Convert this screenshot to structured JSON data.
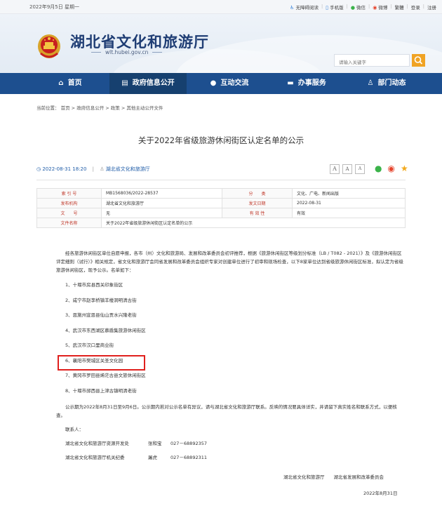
{
  "topbar": {
    "date": "2022年9月5日 星期一",
    "links": [
      {
        "icon": "accessibility-icon",
        "label": "无障碍阅读"
      },
      {
        "icon": "mobile-icon",
        "label": "手机版"
      },
      {
        "icon": "wechat-icon",
        "label": "微信"
      },
      {
        "icon": "weibo-icon",
        "label": "微博"
      },
      {
        "icon": "",
        "label": "繁體"
      },
      {
        "icon": "",
        "label": "登录"
      },
      {
        "icon": "",
        "label": "注册"
      }
    ]
  },
  "header": {
    "site_title": "湖北省文化和旅游厅",
    "domain": "wlt.hubei.gov.cn",
    "search_placeholder": "请输入关键字"
  },
  "nav": {
    "items": [
      {
        "label": "首页",
        "icon": "home-icon"
      },
      {
        "label": "政府信息公开",
        "icon": "document-list-icon"
      },
      {
        "label": "互动交流",
        "icon": "chat-bubble-icon"
      },
      {
        "label": "办事服务",
        "icon": "monitor-icon"
      },
      {
        "label": "部门动态",
        "icon": "person-icon"
      }
    ],
    "active_index": 1
  },
  "breadcrumb": {
    "prefix": "当前位置：",
    "items": [
      "首页",
      "政府信息公开",
      "政策",
      "其他主动公开文件"
    ],
    "separator": ">"
  },
  "article": {
    "title": "关于2022年省级旅游休闲街区认定名单的公示",
    "datetime": "2022-08-31 18:20",
    "source": "湖北省文化和旅游厅",
    "font_buttons": [
      "A",
      "A",
      "A"
    ]
  },
  "info_table": {
    "rows": [
      [
        {
          "k": "索 引 号",
          "v": "MB1568036/2022-28537"
        },
        {
          "k": "分　　类",
          "v": "文化、广电、新闻出版"
        }
      ],
      [
        {
          "k": "发布机构",
          "v": "湖北省文化和旅游厅"
        },
        {
          "k": "发文日期",
          "v": "2022-08-31"
        }
      ],
      [
        {
          "k": "文　　号",
          "v": "无"
        },
        {
          "k": "有 效 性",
          "v": "有效"
        }
      ],
      [
        {
          "k": "文件名称",
          "v": "关于2022年省级旅游休闲街区认定名单的公示"
        }
      ]
    ]
  },
  "content": {
    "intro": "经各旅游休闲街区单位自愿申报，各市（州）文化和旅游局、发展和改革委员会初评推荐，根据《旅游休闲街区等级划分标准（LB / T082 - 2021）》及《旅游休闲街区评定细则（试行）》相关规定，省文化和旅游厅会同省发展和改革委员会组织专家对创建单位进行了初审和现场检查，以下8家单位达到省级旅游休闲街区标准，拟认定为省级旅游休闲街区，现予公示。名单如下：",
    "items": [
      "1、十堰市房县西关印象街区",
      "2、咸宁市赵李桥镇羊楼洞明清古街",
      "3、恩施州宣恩县仙山贡水兴隆老街",
      "4、武汉市东西湖区慕盾集旅游休闲街区",
      "5、武汉市汉口里商业街",
      "6、襄阳市樊城区关圣文化园",
      "7、黄冈市罗田县烯茫古县文旅休闲街区",
      "8、十堰市郧西县上津古镇明清老街"
    ],
    "highlight_index": 5,
    "after": "公示期为2022年8月31日至9月6日。公示期内若对公示名单有异议，请与湖北省文化和旅游厅联系。反映的情况要具体详实，并请留下真实姓名和联系方式，以便核查。",
    "contact_label": "联系人：",
    "contacts": [
      {
        "dept": "湖北省文化和旅游厅资源开发处",
        "name": "张和宝",
        "phone": "027－68892357"
      },
      {
        "dept": "湖北省文化和旅游厅机关纪委",
        "name": "屠虎",
        "phone": "027－68892311"
      }
    ],
    "signature": "湖北省文化和旅游厅　　湖北省发展和改革委员会",
    "sign_date": "2022年8月31日"
  },
  "colors": {
    "nav_bg": "#1d4f8f",
    "title_blue": "#1f3d74",
    "link_blue": "#1f5ca8",
    "search_button": "#f0a324",
    "highlight_red": "#e0201d"
  }
}
